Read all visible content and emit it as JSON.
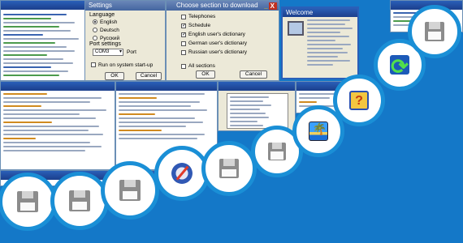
{
  "settings_window": {
    "title": "Settings",
    "language_label": "Language",
    "languages": [
      "English",
      "Deutsch",
      "Русский"
    ],
    "port_settings_label": "Port settings",
    "port_value": "COM3",
    "port_label": "Port",
    "run_on_startup": "Run on system start-up",
    "ok": "OK",
    "cancel": "Cancel"
  },
  "choose_window": {
    "title": "Choose section to download",
    "sections": [
      "Telephones",
      "Schedule",
      "English user's dictionary",
      "German user's dictionary",
      "Russian user's dictionary"
    ],
    "all_sections": "All sections",
    "ok": "OK",
    "cancel": "Cancel"
  },
  "installer_window": {
    "title": "Welcome"
  },
  "colors": {
    "background": "#1478c8",
    "circle_border": "#1a8fd6"
  },
  "icons": [
    "floppy-disk-icon",
    "floppy-disk-icon",
    "floppy-disk-icon",
    "no-entry-spinner-icon",
    "floppy-disk-icon",
    "floppy-disk-icon",
    "island-icon",
    "help-book-icon",
    "sync-arrows-icon",
    "floppy-disk-icon"
  ]
}
